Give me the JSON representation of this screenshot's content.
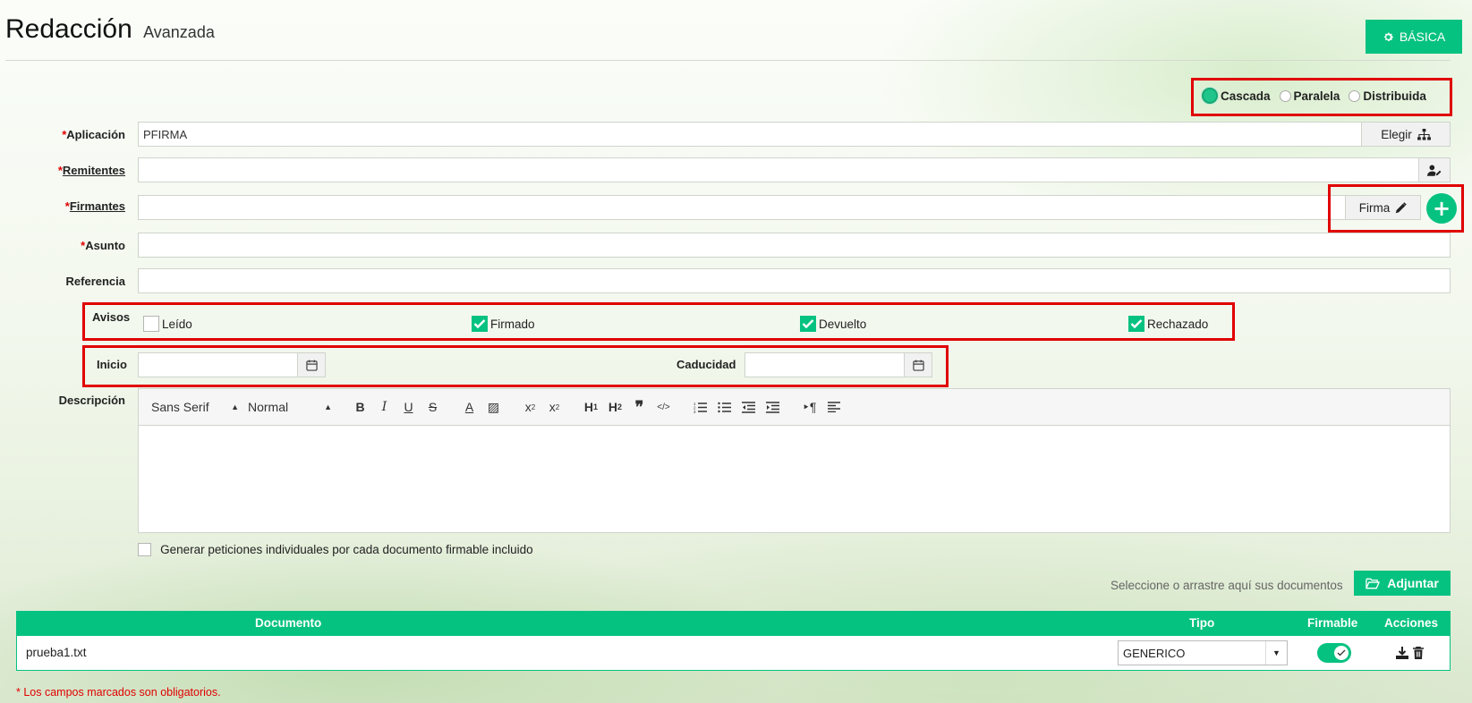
{
  "header": {
    "title": "Redacción",
    "subtitle": "Avanzada",
    "mode_button_label": "BÁSICA"
  },
  "flow": {
    "options": [
      {
        "label": "Cascada",
        "selected": true
      },
      {
        "label": "Paralela",
        "selected": false
      },
      {
        "label": "Distribuida",
        "selected": false
      }
    ]
  },
  "form": {
    "required_mark": "*",
    "aplicacion": {
      "label": "Aplicación",
      "value": "PFIRMA",
      "button_label": "Elegir"
    },
    "remitentes": {
      "label": "Remitentes",
      "value": ""
    },
    "firmantes": {
      "label": "Firmantes",
      "value": "",
      "button_label": "Firma"
    },
    "asunto": {
      "label": "Asunto",
      "value": ""
    },
    "referencia": {
      "label": "Referencia",
      "value": ""
    },
    "avisos": {
      "label": "Avisos",
      "items": [
        {
          "label": "Leído",
          "checked": false
        },
        {
          "label": "Firmado",
          "checked": true
        },
        {
          "label": "Devuelto",
          "checked": true
        },
        {
          "label": "Rechazado",
          "checked": true
        }
      ]
    },
    "inicio": {
      "label": "Inicio",
      "value": ""
    },
    "caducidad": {
      "label": "Caducidad",
      "value": ""
    },
    "descripcion": {
      "label": "Descripción",
      "font_select": "Sans Serif",
      "size_select": "Normal"
    },
    "individual_requests": {
      "label": "Generar peticiones individuales por cada documento firmable incluido",
      "checked": false
    }
  },
  "attachments": {
    "hint": "Seleccione o arrastre aquí sus documentos",
    "button_label": "Adjuntar"
  },
  "table": {
    "headers": {
      "documento": "Documento",
      "tipo": "Tipo",
      "firmable": "Firmable",
      "acciones": "Acciones"
    },
    "rows": [
      {
        "documento": "prueba1.txt",
        "tipo": "GENERICO",
        "firmable": true
      }
    ]
  },
  "footer_note": "* Los campos marcados son obligatorios.",
  "colors": {
    "accent": "#06c281",
    "highlight": "#e00000"
  }
}
